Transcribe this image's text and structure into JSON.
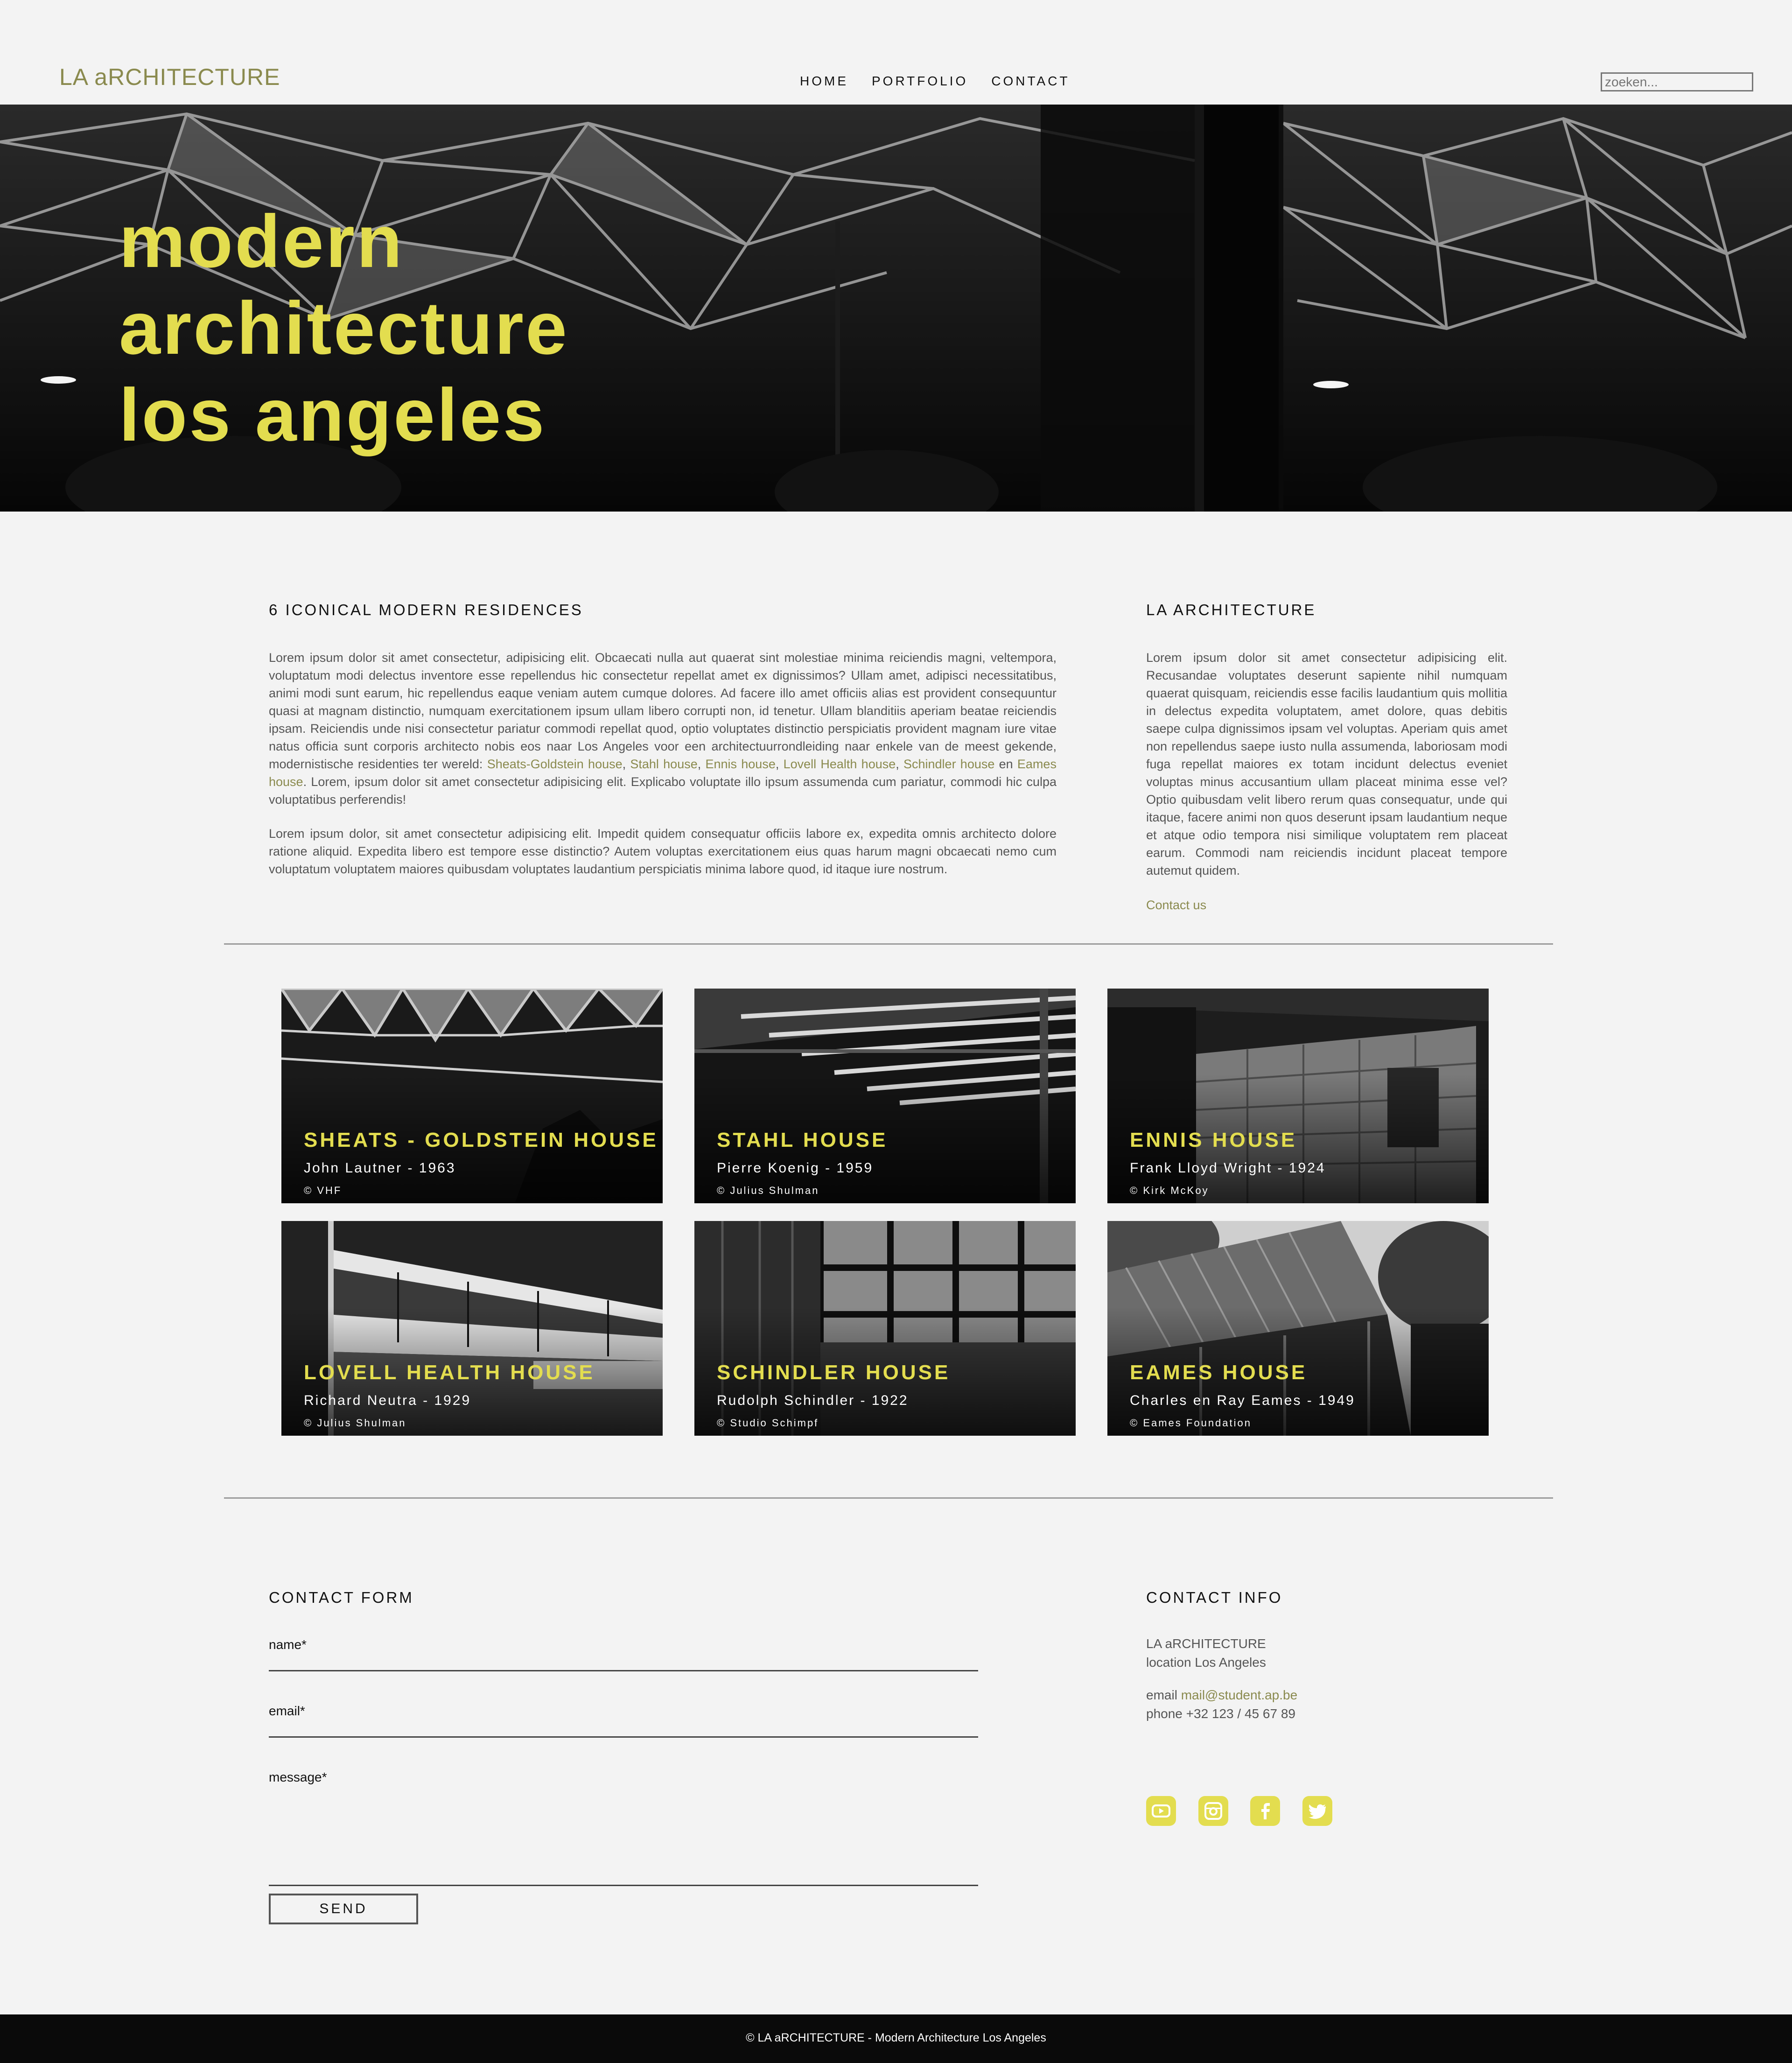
{
  "header": {
    "logo": "LA aRCHITECTURE",
    "nav": [
      "HOME",
      "PORTFOLIO",
      "CONTACT"
    ],
    "search_placeholder": "zoeken..."
  },
  "hero": {
    "lines": [
      "modern",
      "architecture",
      "los angeles"
    ]
  },
  "intro": {
    "title": "6 ICONICAL MODERN RESIDENCES",
    "p1_a": "Lorem ipsum dolor sit amet consectetur, adipisicing elit. Obcaecati nulla aut quaerat sint molestiae minima reiciendis magni, veltempora, voluptatum modi delectus inventore esse repellendus hic consectetur repellat amet ex dignissimos? Ullam amet, adipisci necessitatibus, animi modi sunt earum, hic repellendus eaque veniam autem cumque dolores. Ad facere illo amet officiis alias est provident consequuntur quasi at magnam distinctio, numquam exercitationem ipsum ullam libero corrupti non, id tenetur. Ullam blanditiis aperiam beatae reiciendis ipsam. Reiciendis unde nisi consectetur pariatur commodi repellat quod, optio voluptates distinctio perspiciatis provident magnam iure vitae natus officia sunt corporis architecto nobis eos naar Los Angeles voor een architectuurrondleiding naar enkele van de meest gekende, modernistische residenties ter wereld: ",
    "links": [
      "Sheats-Goldstein house",
      "Stahl house",
      "Ennis house",
      "Lovell Health house",
      "Schindler house",
      "Eames house"
    ],
    "sep_comma": ", ",
    "sep_en": " en ",
    "p1_b": ". Lorem, ipsum dolor sit amet consectetur adipisicing elit. Explicabo voluptate illo ipsum assumenda cum pariatur, commodi hic culpa voluptatibus perferendis!",
    "p2": "Lorem ipsum dolor, sit amet consectetur adipisicing elit. Impedit quidem consequatur officiis labore ex, expedita omnis architecto dolore ratione aliquid. Expedita libero est tempore esse distinctio? Autem voluptas exercitationem eius quas harum magni obcaecati nemo cum voluptatum voluptatem maiores quibusdam voluptates laudantium perspiciatis minima labore quod, id itaque iure nostrum."
  },
  "about": {
    "title": "LA ARCHITECTURE",
    "text": "Lorem ipsum dolor sit amet consectetur adipisicing elit. Recusandae voluptates deserunt sapiente nihil numquam quaerat quisquam, reiciendis esse facilis laudantium quis mollitia in delectus expedita voluptatem, amet dolore, quas debitis saepe culpa dignissimos ipsam vel voluptas. Aperiam quis amet non repellendus saepe iusto nulla assumenda, laboriosam modi fuga repellat maiores ex totam incidunt delectus eveniet voluptas minus accusantium ullam placeat minima esse vel? Optio quibusdam velit libero rerum quas consequatur, unde qui itaque, facere animi non quos deserunt ipsam laudantium neque et atque odio tempora nisi similique voluptatem rem placeat earum. Commodi nam reiciendis incidunt placeat tempore autemut quidem.",
    "link": "Contact us"
  },
  "houses": [
    {
      "title": "SHEATS - GOLDSTEIN HOUSE",
      "architect": "John Lautner - 1963",
      "credit": "© VHF"
    },
    {
      "title": "STAHL HOUSE",
      "architect": "Pierre Koenig - 1959",
      "credit": "© Julius Shulman"
    },
    {
      "title": "ENNIS HOUSE",
      "architect": "Frank Lloyd Wright - 1924",
      "credit": "© Kirk McKoy"
    },
    {
      "title": "LOVELL HEALTH HOUSE",
      "architect": "Richard Neutra - 1929",
      "credit": "© Julius Shulman"
    },
    {
      "title": "SCHINDLER HOUSE",
      "architect": "Rudolph Schindler - 1922",
      "credit": "© Studio Schimpf"
    },
    {
      "title": "EAMES HOUSE",
      "architect": "Charles en Ray Eames - 1949",
      "credit": "© Eames Foundation"
    }
  ],
  "contact_form": {
    "title": "CONTACT FORM",
    "name_label": "name*",
    "email_label": "email*",
    "message_label": "message*",
    "send_label": "SEND"
  },
  "contact_info": {
    "title": "CONTACT INFO",
    "company": "LA aRCHITECTURE",
    "location": "location Los Angeles",
    "email_label": "email ",
    "email": "mail@student.ap.be",
    "phone": "phone +32 123 / 45 67 89"
  },
  "social_icons": [
    "youtube-icon",
    "instagram-icon",
    "facebook-icon",
    "twitter-icon"
  ],
  "footer": {
    "text": "© LA aRCHITECTURE - Modern Architecture Los Angeles"
  },
  "colors": {
    "accent": "#e3dd4f",
    "olive": "#8a8a4e",
    "background": "#f3f3f3",
    "dark": "#0a0a0a"
  }
}
